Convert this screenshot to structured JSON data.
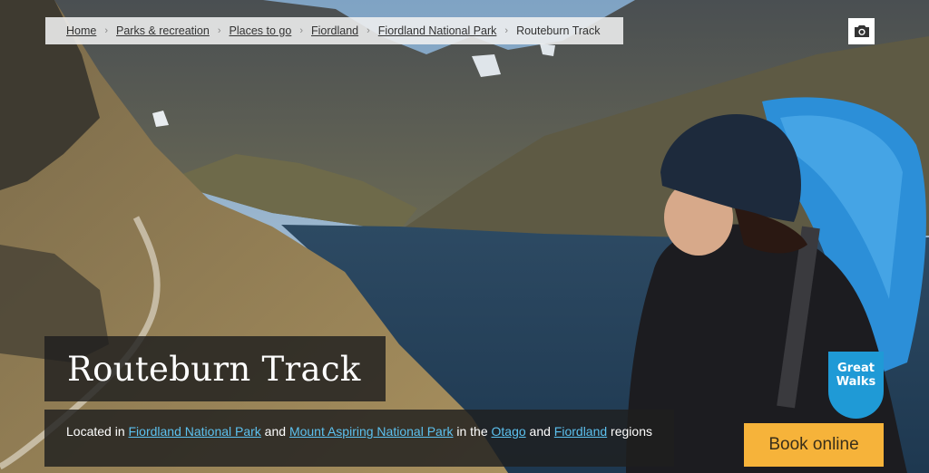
{
  "breadcrumb": {
    "items": [
      "Home",
      "Parks & recreation",
      "Places to go",
      "Fiordland",
      "Fiordland National Park"
    ],
    "current": "Routeburn Track",
    "separator": "›"
  },
  "camera": {
    "icon": "camera-icon"
  },
  "hero": {
    "title": "Routeburn Track",
    "description": {
      "prefix": "Located in ",
      "link1": "Fiordland National Park",
      "and1": " and ",
      "link2": "Mount Aspiring National Park",
      "middle": " in the ",
      "link3": "Otago",
      "and2": " and ",
      "link4": "Fiordland",
      "suffix": " regions"
    }
  },
  "badge": {
    "line1": "Great",
    "line2": "Walks",
    "color": "#1f9ad6"
  },
  "book": {
    "label": "Book online",
    "color": "#f6b33a"
  }
}
